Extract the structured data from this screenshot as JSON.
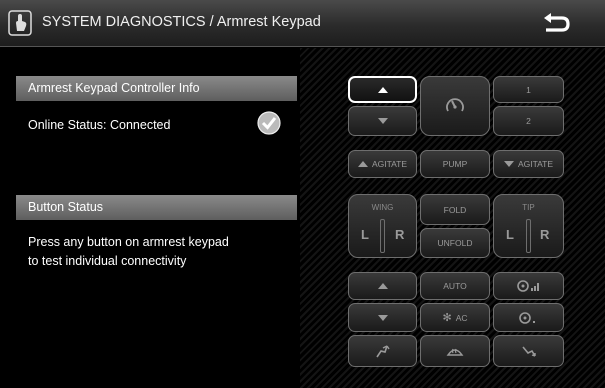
{
  "header": {
    "title": "SYSTEM DIAGNOSTICS / Armrest Keypad",
    "icon": "hand-tap-icon",
    "back_icon": "back-arrow-icon"
  },
  "controller": {
    "section_title": "Armrest Keypad Controller Info",
    "online_status": "Online Status: Connected",
    "status_icon": "check-circle-icon"
  },
  "buttons": {
    "section_title": "Button Status",
    "instructions_line1": "Press any button on armrest keypad",
    "instructions_line2": "to test individual connectivity"
  },
  "keypad": {
    "key_1": "1",
    "key_2": "2",
    "agitate_left": "AGITATE",
    "pump": "PUMP",
    "agitate_right": "AGITATE",
    "wing": "WING",
    "fold": "FOLD",
    "unfold": "UNFOLD",
    "tip": "TIP",
    "left": "L",
    "right": "R",
    "auto": "AUTO",
    "ac": "AC",
    "colors": {
      "active_border": "#ffffff",
      "key_border": "#6e6e6e",
      "header_bg": "#3a3a3a",
      "section_bar": "#707070"
    }
  }
}
